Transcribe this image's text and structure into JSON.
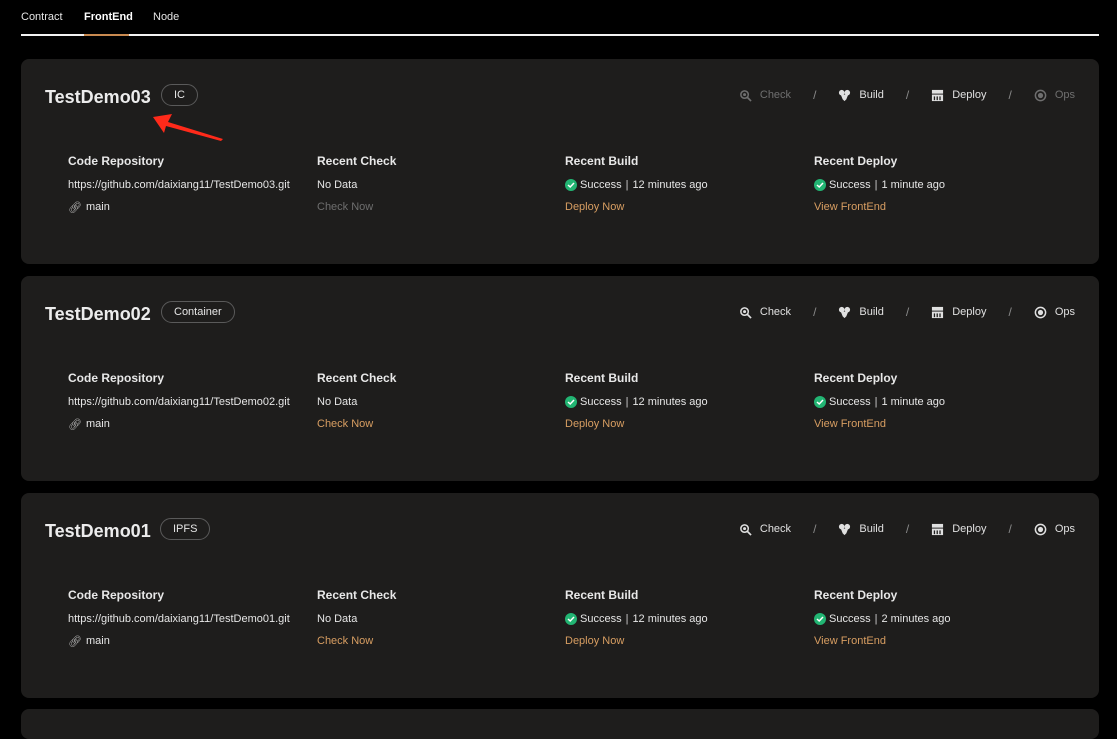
{
  "tabs": [
    {
      "label": "Contract",
      "active": false
    },
    {
      "label": "FrontEnd",
      "active": true
    },
    {
      "label": "Node",
      "active": false
    }
  ],
  "colors": {
    "accent": "#d89e62",
    "success": "#22b573",
    "card_bg": "#1e1d1c",
    "annotation_arrow": "#ff2a1a"
  },
  "step_labels": {
    "check": "Check",
    "build": "Build",
    "deploy": "Deploy",
    "ops": "Ops",
    "separator": "/"
  },
  "column_headers": {
    "repo": "Code Repository",
    "check": "Recent Check",
    "build": "Recent Build",
    "deploy": "Recent Deploy"
  },
  "projects": [
    {
      "name": "TestDemo03",
      "badge": "IC",
      "steps_enabled": {
        "check": false,
        "build": true,
        "deploy": true,
        "ops": false
      },
      "repo_url": "https://github.com/daixiang11/TestDemo03.git",
      "branch": "main",
      "check_status": "No Data",
      "check_action": "Check Now",
      "check_action_enabled": false,
      "build_status": "Success",
      "build_time": "12 minutes ago",
      "build_action": "Deploy Now",
      "deploy_status": "Success",
      "deploy_time": "1 minute ago",
      "deploy_action": "View FrontEnd"
    },
    {
      "name": "TestDemo02",
      "badge": "Container",
      "steps_enabled": {
        "check": true,
        "build": true,
        "deploy": true,
        "ops": true
      },
      "repo_url": "https://github.com/daixiang11/TestDemo02.git",
      "branch": "main",
      "check_status": "No Data",
      "check_action": "Check Now",
      "check_action_enabled": true,
      "build_status": "Success",
      "build_time": "12 minutes ago",
      "build_action": "Deploy Now",
      "deploy_status": "Success",
      "deploy_time": "1 minute ago",
      "deploy_action": "View FrontEnd"
    },
    {
      "name": "TestDemo01",
      "badge": "IPFS",
      "steps_enabled": {
        "check": true,
        "build": true,
        "deploy": true,
        "ops": true
      },
      "repo_url": "https://github.com/daixiang11/TestDemo01.git",
      "branch": "main",
      "check_status": "No Data",
      "check_action": "Check Now",
      "check_action_enabled": true,
      "build_status": "Success",
      "build_time": "12 minutes ago",
      "build_action": "Deploy Now",
      "deploy_status": "Success",
      "deploy_time": "2 minutes ago",
      "deploy_action": "View FrontEnd"
    }
  ]
}
